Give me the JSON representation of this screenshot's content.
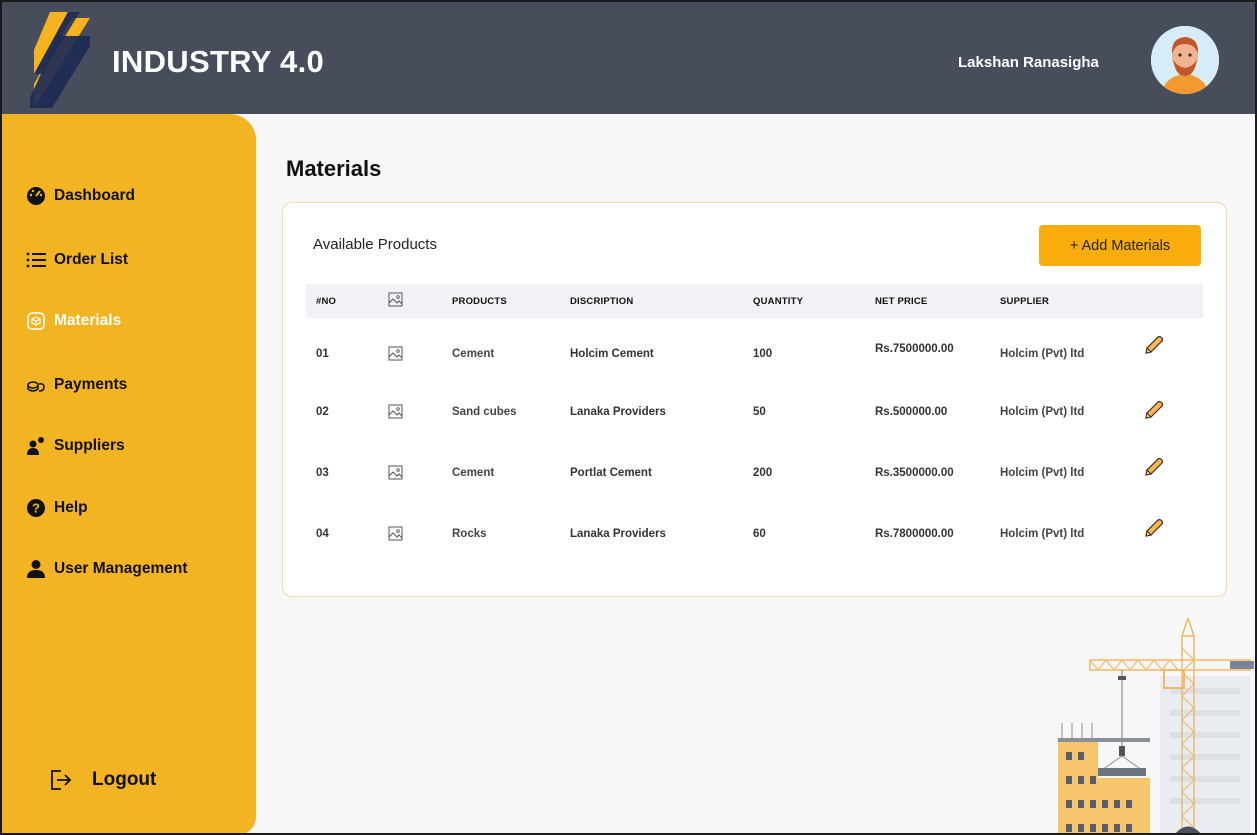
{
  "header": {
    "app_title": "INDUSTRY 4.0",
    "user_name": "Lakshan Ranasigha",
    "background_color": "#474d5a"
  },
  "sidebar": {
    "accent_color": "#f2b422",
    "items": [
      {
        "label": "Dashboard",
        "icon": "speedometer-icon",
        "active": false
      },
      {
        "label": "Order List",
        "icon": "list-icon",
        "active": false
      },
      {
        "label": "Materials",
        "icon": "box-icon",
        "active": true
      },
      {
        "label": "Payments",
        "icon": "coins-icon",
        "active": false
      },
      {
        "label": "Suppliers",
        "icon": "people-icon",
        "active": false
      },
      {
        "label": "Help",
        "icon": "question-icon",
        "active": false
      },
      {
        "label": "User Management",
        "icon": "user-icon",
        "active": false
      }
    ],
    "logout_label": "Logout"
  },
  "main": {
    "page_title": "Materials",
    "card_title": "Available Products",
    "add_button_label": "+ Add Materials",
    "columns": [
      "#NO",
      "image-icon",
      "PRODUCTS",
      "DISCRIPTION",
      "QUANTITY",
      "NET PRICE",
      "SUPPLIER"
    ],
    "rows": [
      {
        "no": "01",
        "product": "Cement",
        "description": "Holcim Cement",
        "quantity": "100",
        "net_price": "Rs.7500000.00",
        "supplier": "Holcim (Pvt) ltd"
      },
      {
        "no": "02",
        "product": "Sand cubes",
        "description": "Lanaka Providers",
        "quantity": "50",
        "net_price": "Rs.500000.00",
        "supplier": "Holcim (Pvt) ltd"
      },
      {
        "no": "03",
        "product": "Cement",
        "description": "Portlat Cement",
        "quantity": "200",
        "net_price": "Rs.3500000.00",
        "supplier": "Holcim (Pvt) ltd"
      },
      {
        "no": "04",
        "product": "Rocks",
        "description": "Lanaka Providers",
        "quantity": "60",
        "net_price": "Rs.7800000.00",
        "supplier": "Holcim (Pvt) ltd"
      }
    ],
    "button_color": "#f8ad0c"
  }
}
